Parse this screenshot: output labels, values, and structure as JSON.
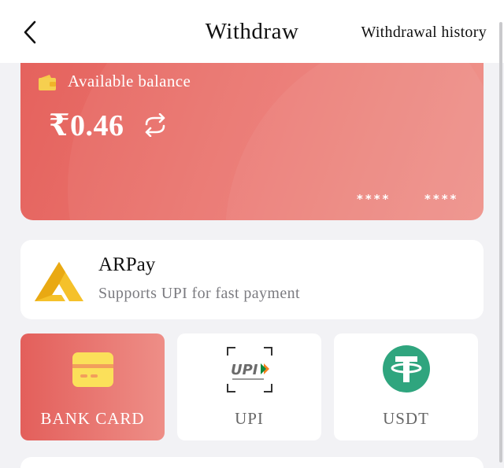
{
  "header": {
    "title": "Withdraw",
    "history_label": "Withdrawal history"
  },
  "balance": {
    "label": "Available balance",
    "amount": "₹0.46",
    "masked_1": "****",
    "masked_2": "****"
  },
  "provider": {
    "name": "ARPay",
    "description": "Supports UPI for fast payment"
  },
  "methods": [
    {
      "label": "BANK CARD",
      "icon": "bank-card-icon",
      "selected": true
    },
    {
      "label": "UPI",
      "icon": "upi-logo",
      "selected": false
    },
    {
      "label": "USDT",
      "icon": "tether-icon",
      "selected": false
    }
  ],
  "colors": {
    "accent": "#e5625d",
    "card_icon": "#fbe05a",
    "tether": "#2fa57e",
    "arpay": "#f5c12a"
  }
}
